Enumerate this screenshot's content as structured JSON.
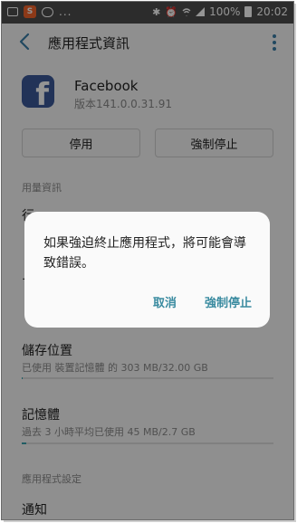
{
  "status_bar": {
    "app_badge": "S",
    "overflow_dots": "...",
    "bluetooth_glyph": "✱",
    "alarm_glyph": "⏰",
    "battery_percent": "100%",
    "time": "20:02",
    "battery_level": 1.0
  },
  "app_bar": {
    "title": "應用程式資訊",
    "back_icon": "back-arrow-icon",
    "more_icon": "more-vertical-icon"
  },
  "app": {
    "icon_letter": "f",
    "name": "Facebook",
    "version": "版本141.0.0.31.91"
  },
  "buttons": {
    "disable": "停用",
    "force_stop": "強制停止"
  },
  "sections": {
    "usage_label": "用量資訊",
    "app_settings_label": "應用程式設定"
  },
  "hidden_rows": {
    "row1_glyph": "行",
    "row2_glyph": "ー"
  },
  "storage": {
    "title": "儲存位置",
    "detail": "已使用 裝置記憶體 的 303 MB/32.00 GB",
    "used_fraction": 0.0
  },
  "memory": {
    "title": "記憶體",
    "detail": "過去 3 小時平均已使用 45 MB/2.7 GB",
    "used_fraction": 0.017
  },
  "notifications": {
    "title": "通知"
  },
  "dialog": {
    "message": "如果強迫終止應用程式，將可能會導致錯誤。",
    "cancel": "取消",
    "confirm": "強制停止"
  },
  "colors": {
    "accent": "#3a8ba0",
    "facebook_blue": "#3b5998",
    "status_bar": "#4c4c4c"
  }
}
